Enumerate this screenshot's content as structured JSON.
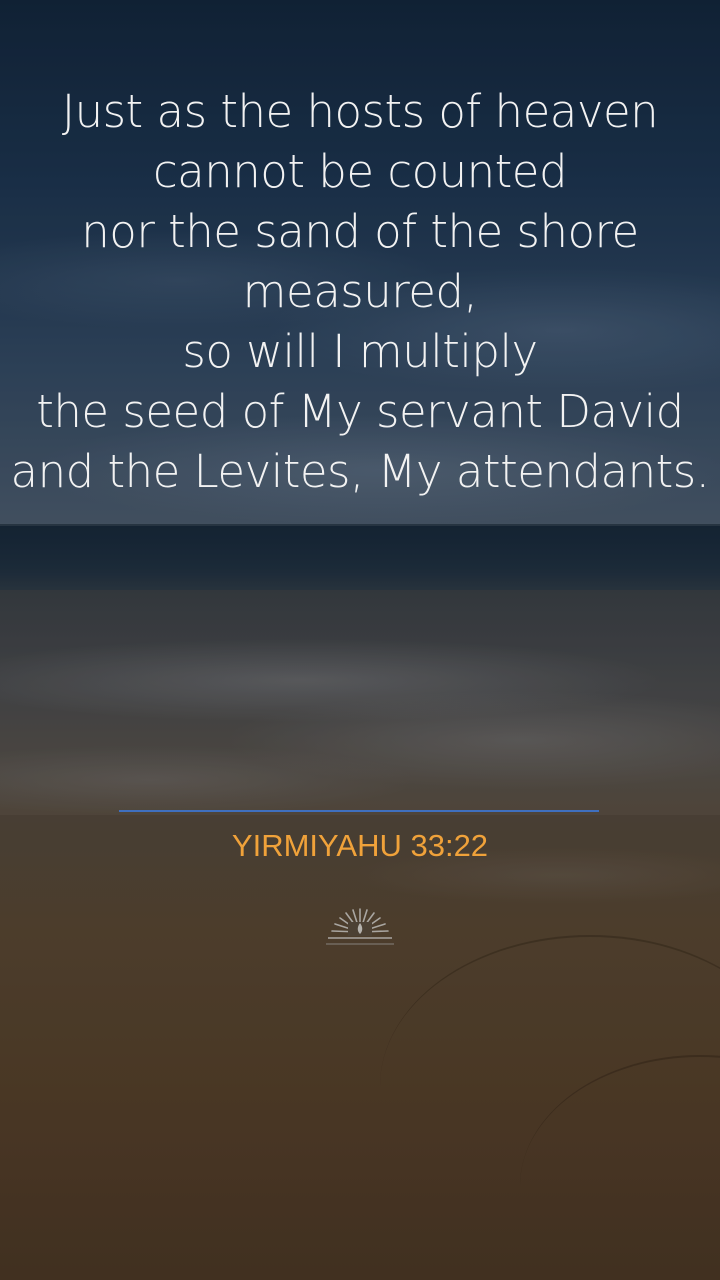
{
  "verse": {
    "lines": [
      "Just as the hosts of heaven",
      "cannot be counted",
      "nor the sand of the shore",
      "measured,",
      "so will I multiply",
      "the seed of My servant David",
      "and the Levites, My attendants."
    ]
  },
  "reference": {
    "text": "YIRMIYAHU 33:22"
  },
  "logo": {
    "icon": "sunrise-candle-icon"
  },
  "colors": {
    "verse_text": "#f2f2f2",
    "reference_text": "#f0a23a",
    "divider": "#3f6fbf"
  }
}
